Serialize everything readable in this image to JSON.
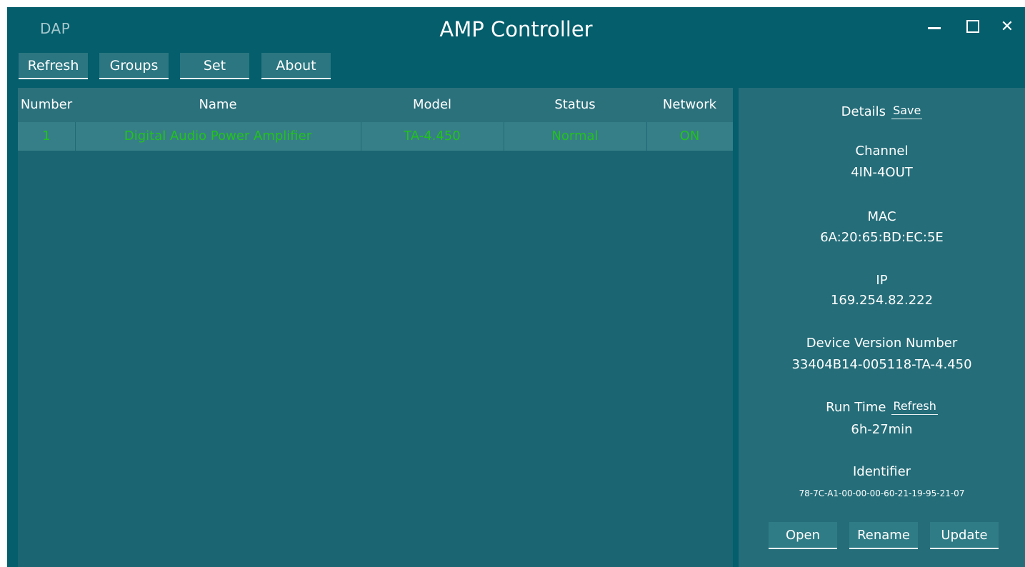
{
  "window": {
    "brand": "DAP",
    "title": "AMP Controller",
    "min_icon": "minimize-icon",
    "max_icon": "maximize-icon",
    "close_icon": "close-icon",
    "close_glyph": "✕"
  },
  "toolbar": {
    "refresh": "Refresh",
    "groups": "Groups",
    "set": "Set",
    "about": "About"
  },
  "table": {
    "headers": [
      "Number",
      "Name",
      "Model",
      "Status",
      "Network"
    ],
    "rows": [
      [
        "1",
        "Digital Audio Power Amplifier",
        "TA-4.450",
        "Normal",
        "ON"
      ]
    ]
  },
  "details": {
    "title": "Details",
    "save": "Save",
    "channel_label": "Channel",
    "channel_value": "4IN-4OUT",
    "mac_label": "MAC",
    "mac_value": "6A:20:65:BD:EC:5E",
    "ip_label": "IP",
    "ip_value": "169.254.82.222",
    "version_label": "Device Version Number",
    "version_value": "33404B14-005118-TA-4.450",
    "runtime_label": "Run Time",
    "runtime_refresh": "Refresh",
    "runtime_value": "6h-27min",
    "identifier_label": "Identifier",
    "identifier_value": "78-7C-A1-00-00-00-60-21-19-95-21-07"
  },
  "actions": {
    "open": "Open",
    "rename": "Rename",
    "update": "Update"
  },
  "colors": {
    "background": "#045e6c",
    "table_bg": "#1a6571",
    "details_bg": "#246d79",
    "row_text": "#22c31c",
    "button_bg": "#2b7681"
  }
}
